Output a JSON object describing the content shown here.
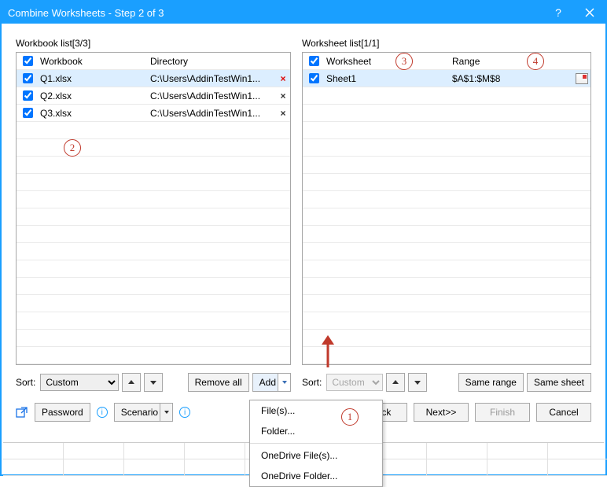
{
  "title": "Combine Worksheets - Step 2 of 3",
  "workbook_panel": {
    "label": "Workbook list[3/3]",
    "header_chk": true,
    "col_name": "Workbook",
    "col_dir": "Directory",
    "rows": [
      {
        "chk": true,
        "name": "Q1.xlsx",
        "dir": "C:\\Users\\AddinTestWin1...",
        "selected": true
      },
      {
        "chk": true,
        "name": "Q2.xlsx",
        "dir": "C:\\Users\\AddinTestWin1...",
        "selected": false
      },
      {
        "chk": true,
        "name": "Q3.xlsx",
        "dir": "C:\\Users\\AddinTestWin1...",
        "selected": false
      }
    ]
  },
  "worksheet_panel": {
    "label": "Worksheet list[1/1]",
    "header_chk": true,
    "col_name": "Worksheet",
    "col_range": "Range",
    "rows": [
      {
        "chk": true,
        "name": "Sheet1",
        "range": "$A$1:$M$8",
        "selected": true
      }
    ]
  },
  "sort": {
    "label": "Sort:",
    "left_value": "Custom",
    "right_value": "Custom",
    "remove_all": "Remove all",
    "add": "Add",
    "same_range": "Same range",
    "same_sheet": "Same sheet"
  },
  "dropdown_items": {
    "files": "File(s)...",
    "folder": "Folder...",
    "od_files": "OneDrive File(s)...",
    "od_folder": "OneDrive Folder..."
  },
  "bottom": {
    "password": "Password",
    "scenario": "Scenario",
    "back": "ack",
    "next": "Next>>",
    "finish": "Finish",
    "cancel": "Cancel"
  },
  "annotations": {
    "a1": "1",
    "a2": "2",
    "a3": "3",
    "a4": "4"
  }
}
